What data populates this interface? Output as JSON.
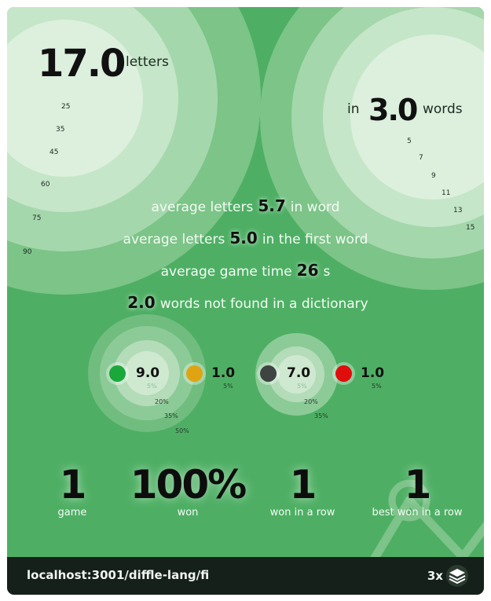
{
  "letters": {
    "value": "17.0",
    "label": "letters",
    "ticks": [
      "25",
      "35",
      "45",
      "60",
      "75",
      "90"
    ]
  },
  "words": {
    "prefix": "in",
    "value": "3.0",
    "label": "words",
    "ticks": [
      "5",
      "7",
      "9",
      "11",
      "13",
      "15"
    ]
  },
  "stats": [
    {
      "pre": "average letters",
      "value": "5.7",
      "post": "in word"
    },
    {
      "pre": "average letters",
      "value": "5.0",
      "post": "in the first word"
    },
    {
      "pre": "average game time",
      "value": "26",
      "post": "s"
    },
    {
      "pre": "",
      "value": "2.0",
      "post": "words not found in a dictionary"
    }
  ],
  "pie_left": {
    "main": "9.0",
    "side": "1.0",
    "side_pct": "5%",
    "ticks": [
      "5%",
      "20%",
      "35%",
      "50%"
    ]
  },
  "pie_right": {
    "main": "7.0",
    "side": "1.0",
    "side_pct": "5%",
    "ticks": [
      "5%",
      "20%",
      "35%"
    ]
  },
  "colors": {
    "green": "#1aa83a",
    "yellow": "#e0a412",
    "gray": "#3e4442",
    "red": "#e00d0d"
  },
  "summary": [
    {
      "value": "1",
      "label": "game"
    },
    {
      "value": "100%",
      "label": "won"
    },
    {
      "value": "1",
      "label": "won in a row"
    },
    {
      "value": "1",
      "label": "best won in a row"
    }
  ],
  "footer": {
    "url": "localhost:3001/diffle-lang/fi",
    "zoom": "3x",
    "icon": "layers-icon"
  }
}
